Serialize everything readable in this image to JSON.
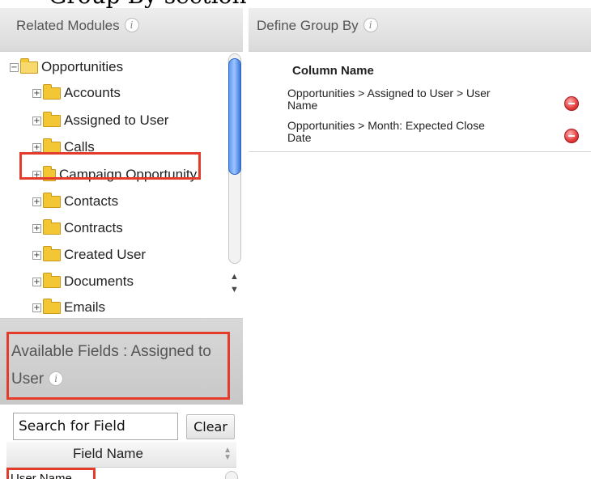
{
  "top_caption": "Group By section",
  "left_panel": {
    "title": "Related Modules",
    "tree": {
      "root": "Opportunities",
      "children": [
        {
          "label": "Accounts"
        },
        {
          "label": "Assigned to User"
        },
        {
          "label": "Calls"
        },
        {
          "label": "Campaign Opportunity"
        },
        {
          "label": "Contacts"
        },
        {
          "label": "Contracts"
        },
        {
          "label": "Created User"
        },
        {
          "label": "Documents"
        },
        {
          "label": "Emails"
        }
      ]
    },
    "available_fields": {
      "title": "Available Fields : Assigned to User"
    },
    "search": {
      "value": "Search for Field",
      "clear_label": "Clear"
    },
    "fields_table": {
      "header": "Field Name",
      "rows": [
        "User Name"
      ]
    }
  },
  "right_panel": {
    "title": "Define Group By",
    "column_header": "Column Name",
    "groups": [
      {
        "line1": "Opportunities > Assigned to User > User",
        "line2": "Name"
      },
      {
        "line1": "Opportunities > Month: Expected Close",
        "line2": "Date"
      }
    ]
  },
  "colors": {
    "highlight": "#e53b2a",
    "folder": "#f3c633",
    "scroll_thumb": "#3c77d8",
    "remove_icon": "#e23b3b"
  }
}
